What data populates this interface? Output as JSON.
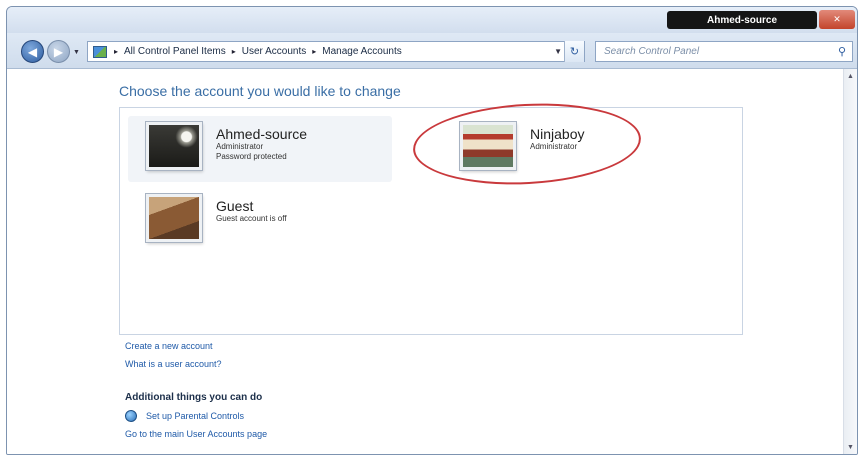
{
  "window": {
    "current_user": "Ahmed-source",
    "close_label": "✕"
  },
  "toolbar": {
    "back_glyph": "◀",
    "forward_glyph": "▶",
    "address": {
      "crumbs": [
        "All Control Panel Items",
        "User Accounts",
        "Manage Accounts"
      ],
      "separator": "▸",
      "refresh_glyph": "↻",
      "icon": "control-panel-icon"
    },
    "search": {
      "placeholder": "Search Control Panel",
      "icon": "search-icon"
    }
  },
  "main": {
    "heading": "Choose the account you would like to change",
    "accounts": [
      {
        "name": "Ahmed-source",
        "lines": [
          "Administrator",
          "Password protected"
        ],
        "avatar": "dark-photo"
      },
      {
        "name": "Ninjaboy",
        "lines": [
          "Administrator"
        ],
        "avatar": "crew-photo"
      },
      {
        "name": "Guest",
        "lines": [
          "Guest account is off"
        ],
        "avatar": "guest-photo"
      }
    ],
    "links": {
      "create": "Create a new account",
      "what": "What is a user account?"
    },
    "additional": {
      "title": "Additional things you can do",
      "parental": "Set up Parental Controls",
      "main_page": "Go to the main User Accounts page"
    }
  },
  "colors": {
    "heading": "#3a6ea5",
    "link": "#1f5aa8",
    "highlight": "#c9393c"
  }
}
